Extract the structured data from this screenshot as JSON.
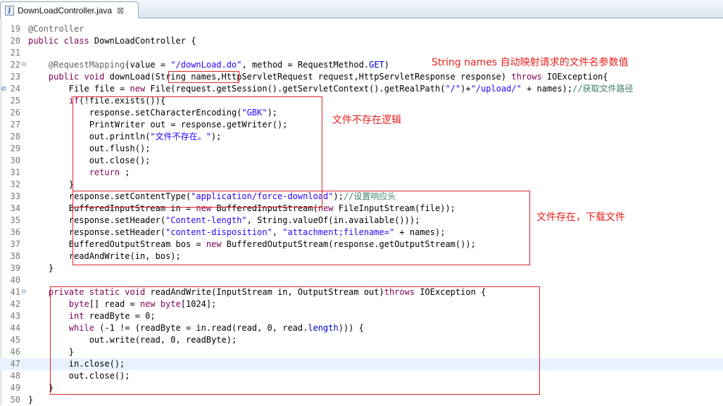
{
  "tab": {
    "icon": "java-file-icon",
    "title": "DownLoadController.java",
    "close": "⊠"
  },
  "lines": [
    {
      "n": "19",
      "tokens": [
        {
          "t": "@Controller",
          "c": "ann"
        }
      ]
    },
    {
      "n": "20",
      "tokens": [
        {
          "t": "public class",
          "c": "kw"
        },
        {
          "t": " DownLoadController {"
        }
      ]
    },
    {
      "n": "21",
      "tokens": []
    },
    {
      "n": "22",
      "fold": "⊖",
      "tokens": [
        {
          "t": "    @RequestMapping",
          "c": "ann"
        },
        {
          "t": "(value = "
        },
        {
          "t": "\"/downLoad.do\"",
          "c": "str"
        },
        {
          "t": ", method = RequestMethod."
        },
        {
          "t": "GET",
          "c": "fld it"
        },
        {
          "t": ")"
        }
      ]
    },
    {
      "n": "23",
      "tokens": [
        {
          "t": "    public void",
          "c": "kw"
        },
        {
          "t": " downLoad(String names,HttpServletRequest request,HttpServletResponse response) "
        },
        {
          "t": "throws",
          "c": "kw"
        },
        {
          "t": " IOException{"
        }
      ]
    },
    {
      "n": "24",
      "mark": "⊘",
      "tokens": [
        {
          "t": "        File file = "
        },
        {
          "t": "new",
          "c": "kw"
        },
        {
          "t": " File(request.getSession().getServletContext().getRealPath("
        },
        {
          "t": "\"/\"",
          "c": "str"
        },
        {
          "t": ")+"
        },
        {
          "t": "\"/upload/\"",
          "c": "str"
        },
        {
          "t": " + names);"
        },
        {
          "t": "//获取文件路径",
          "c": "cmt"
        }
      ]
    },
    {
      "n": "25",
      "tokens": [
        {
          "t": "        if",
          "c": "kw"
        },
        {
          "t": "(!file.exists()){"
        }
      ]
    },
    {
      "n": "26",
      "tokens": [
        {
          "t": "            response.setCharacterEncoding("
        },
        {
          "t": "\"GBK\"",
          "c": "str"
        },
        {
          "t": ");"
        }
      ]
    },
    {
      "n": "27",
      "tokens": [
        {
          "t": "            PrintWriter out = response.getWriter();"
        }
      ]
    },
    {
      "n": "28",
      "tokens": [
        {
          "t": "            out.println("
        },
        {
          "t": "\"文件不存在。\"",
          "c": "str"
        },
        {
          "t": ");"
        }
      ]
    },
    {
      "n": "29",
      "tokens": [
        {
          "t": "            out.flush();"
        }
      ]
    },
    {
      "n": "30",
      "tokens": [
        {
          "t": "            out.close();"
        }
      ]
    },
    {
      "n": "31",
      "tokens": [
        {
          "t": "            return",
          "c": "kw"
        },
        {
          "t": " ;"
        }
      ]
    },
    {
      "n": "32",
      "tokens": [
        {
          "t": "        }"
        }
      ]
    },
    {
      "n": "33",
      "tokens": [
        {
          "t": "        response.setContentType("
        },
        {
          "t": "\"application/force-download\"",
          "c": "str"
        },
        {
          "t": ");"
        },
        {
          "t": "//设置响应头",
          "c": "cmt"
        }
      ]
    },
    {
      "n": "34",
      "tokens": [
        {
          "t": "        BufferedInputStream in = "
        },
        {
          "t": "new",
          "c": "kw"
        },
        {
          "t": " BufferedInputStream("
        },
        {
          "t": "new",
          "c": "kw"
        },
        {
          "t": " FileInputStream(file));"
        }
      ]
    },
    {
      "n": "35",
      "tokens": [
        {
          "t": "        response.setHeader("
        },
        {
          "t": "\"Content-length\"",
          "c": "str"
        },
        {
          "t": ", String."
        },
        {
          "t": "valueOf",
          "c": "it"
        },
        {
          "t": "(in.available()));"
        }
      ]
    },
    {
      "n": "36",
      "tokens": [
        {
          "t": "        response.setHeader("
        },
        {
          "t": "\"content-disposition\"",
          "c": "str"
        },
        {
          "t": ", "
        },
        {
          "t": "\"attachment;filename=\"",
          "c": "str"
        },
        {
          "t": " + names);"
        }
      ]
    },
    {
      "n": "37",
      "tokens": [
        {
          "t": "        BufferedOutputStream bos = "
        },
        {
          "t": "new",
          "c": "kw"
        },
        {
          "t": " BufferedOutputStream(response.getOutputStream());"
        }
      ]
    },
    {
      "n": "38",
      "tokens": [
        {
          "t": "        "
        },
        {
          "t": "readAndWrite",
          "c": "it"
        },
        {
          "t": "(in, bos);"
        }
      ]
    },
    {
      "n": "39",
      "tokens": [
        {
          "t": "    }"
        }
      ]
    },
    {
      "n": "40",
      "tokens": []
    },
    {
      "n": "41",
      "fold": "⊖",
      "tokens": [
        {
          "t": "    private static void",
          "c": "kw"
        },
        {
          "t": " readAndWrite(InputStream in, OutputStream out)"
        },
        {
          "t": "throws",
          "c": "kw"
        },
        {
          "t": " IOException {"
        }
      ]
    },
    {
      "n": "42",
      "tokens": [
        {
          "t": "        byte",
          "c": "kw"
        },
        {
          "t": "[] read = "
        },
        {
          "t": "new",
          "c": "kw"
        },
        {
          "t": " "
        },
        {
          "t": "byte",
          "c": "kw"
        },
        {
          "t": "[1024];"
        }
      ]
    },
    {
      "n": "43",
      "tokens": [
        {
          "t": "        int",
          "c": "kw"
        },
        {
          "t": " readByte = 0;"
        }
      ]
    },
    {
      "n": "44",
      "tokens": [
        {
          "t": "        while",
          "c": "kw"
        },
        {
          "t": " (-1 != (readByte = in.read(read, 0, read."
        },
        {
          "t": "length",
          "c": "fld"
        },
        {
          "t": "))) {"
        }
      ]
    },
    {
      "n": "45",
      "tokens": [
        {
          "t": "            out.write(read, 0, readByte);"
        }
      ]
    },
    {
      "n": "46",
      "tokens": [
        {
          "t": "        }"
        }
      ]
    },
    {
      "n": "47",
      "current": true,
      "tokens": [
        {
          "t": "        in.close();"
        }
      ]
    },
    {
      "n": "48",
      "tokens": [
        {
          "t": "        out.close();"
        }
      ]
    },
    {
      "n": "49",
      "tokens": [
        {
          "t": "    }"
        }
      ]
    },
    {
      "n": "50",
      "tokens": [
        {
          "t": "}"
        }
      ]
    }
  ],
  "annotations": {
    "names_note": "String names 自动映射请求的文件名参数值",
    "not_exist_note": "文件不存在逻辑",
    "exist_note": "文件存在，下载文件"
  },
  "colors": {
    "annotation_red": "#e8211d",
    "keyword": "#7f0055",
    "string": "#2a00ff",
    "comment": "#3f7f5f"
  }
}
